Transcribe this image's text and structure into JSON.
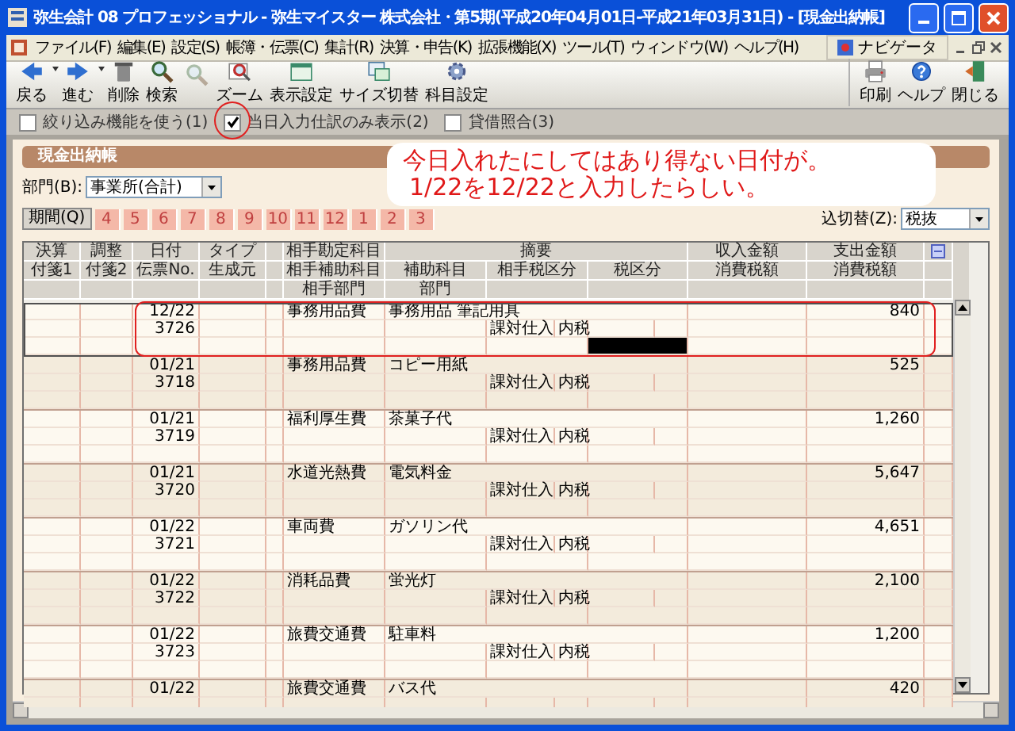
{
  "window": {
    "title": "弥生会計 08 プロフェッショナル - 弥生マイスター 株式会社・第5期(平成20年04月01日-平成21年03月31日) - [現金出納帳]"
  },
  "menu": [
    "ファイル(F)",
    "編集(E)",
    "設定(S)",
    "帳簿・伝票(C)",
    "集計(R)",
    "決算・申告(K)",
    "拡張機能(X)",
    "ツール(T)",
    "ウィンドウ(W)",
    "ヘルプ(H)"
  ],
  "navigator": "ナビゲータ",
  "toolbar": {
    "left": [
      {
        "kind": "back",
        "label": "戻る",
        "dropdown": true,
        "disabled": false
      },
      {
        "kind": "forward",
        "label": "進む",
        "dropdown": true,
        "disabled": false
      },
      {
        "kind": "trash",
        "label": "削除",
        "dropdown": false,
        "disabled": false
      },
      {
        "kind": "search",
        "label": "検索",
        "dropdown": false,
        "disabled": false
      },
      {
        "kind": "search",
        "dropdown": false,
        "disabled": true
      },
      {
        "kind": "zoom",
        "label": "ズーム",
        "dropdown": false,
        "disabled": false
      },
      {
        "kind": "window",
        "label": "表示設定",
        "dropdown": false,
        "disabled": false
      },
      {
        "kind": "resize",
        "label": "サイズ切替",
        "dropdown": false,
        "disabled": false
      },
      {
        "kind": "gear",
        "label": "科目設定",
        "dropdown": false,
        "disabled": false
      }
    ],
    "right": [
      {
        "kind": "printer",
        "label": "印刷",
        "dropdown": false,
        "disabled": false
      },
      {
        "kind": "help",
        "label": "ヘルプ",
        "dropdown": false,
        "disabled": false
      },
      {
        "kind": "door",
        "label": "閉じる",
        "dropdown": false,
        "disabled": false
      }
    ]
  },
  "options": [
    {
      "label": "絞り込み機能を使う(1)",
      "checked": false
    },
    {
      "label": "当日入力仕訳のみ表示(2)",
      "checked": true
    },
    {
      "label": "貸借照合(3)",
      "checked": false
    }
  ],
  "panel": {
    "title": "現金出納帳",
    "department": {
      "label": "部門(B):",
      "value": "事業所(合計)"
    },
    "period": {
      "label": "期間(Q)",
      "months": [
        "4",
        "5",
        "6",
        "7",
        "8",
        "9",
        "10",
        "11",
        "12",
        "1",
        "2",
        "3"
      ]
    },
    "tax_mode": {
      "label": "込切替(Z):",
      "value": "税抜"
    }
  },
  "annotation": {
    "lines": [
      "今日入れたにしてはあり得ない日付が。",
      "1/22を12/22と入力したらしい。"
    ]
  },
  "table": {
    "columns": {
      "settlement": "決算",
      "adjustment": "調整",
      "date": "日付",
      "type": "タイプ",
      "partner_account": "相手勘定科目",
      "description": "摘要",
      "income": "収入金額",
      "expense": "支出金額",
      "tag_1": "付箋1",
      "tag_2": "付箋2",
      "slip_no": "伝票No.",
      "source": "生成元",
      "partner_sub_account": "相手補助科目",
      "sub_account": "補助科目",
      "partner_tax_class": "相手税区分",
      "tax_class": "税区分",
      "income_tax": "消費税額",
      "expense_tax": "消費税額",
      "partner_department": "相手部門",
      "department": "部門"
    },
    "entries": [
      {
        "date": "12/22",
        "slip_no": "3726",
        "account": "事務用品費",
        "description": "事務用品 筆記用具",
        "partner_tax_class": "課対仕入",
        "tax_class": "内税",
        "expense": "840",
        "selected": true
      },
      {
        "date": "01/21",
        "slip_no": "3718",
        "account": "事務用品費",
        "description": "コピー用紙",
        "partner_tax_class": "課対仕入",
        "tax_class": "内税",
        "expense": "525",
        "selected": false
      },
      {
        "date": "01/21",
        "slip_no": "3719",
        "account": "福利厚生費",
        "description": "茶菓子代",
        "partner_tax_class": "課対仕入",
        "tax_class": "内税",
        "expense": "1,260",
        "selected": false
      },
      {
        "date": "01/21",
        "slip_no": "3720",
        "account": "水道光熱費",
        "description": "電気料金",
        "partner_tax_class": "課対仕入",
        "tax_class": "内税",
        "expense": "5,647",
        "selected": false
      },
      {
        "date": "01/22",
        "slip_no": "3721",
        "account": "車両費",
        "description": "ガソリン代",
        "partner_tax_class": "課対仕入",
        "tax_class": "内税",
        "expense": "4,651",
        "selected": false
      },
      {
        "date": "01/22",
        "slip_no": "3722",
        "account": "消耗品費",
        "description": "蛍光灯",
        "partner_tax_class": "課対仕入",
        "tax_class": "内税",
        "expense": "2,100",
        "selected": false
      },
      {
        "date": "01/22",
        "slip_no": "3723",
        "account": "旅費交通費",
        "description": "駐車料",
        "partner_tax_class": "課対仕入",
        "tax_class": "内税",
        "expense": "1,200",
        "selected": false
      },
      {
        "date": "01/22",
        "account": "旅費交通費",
        "description": "バス代",
        "expense": "420",
        "selected": false
      }
    ]
  }
}
